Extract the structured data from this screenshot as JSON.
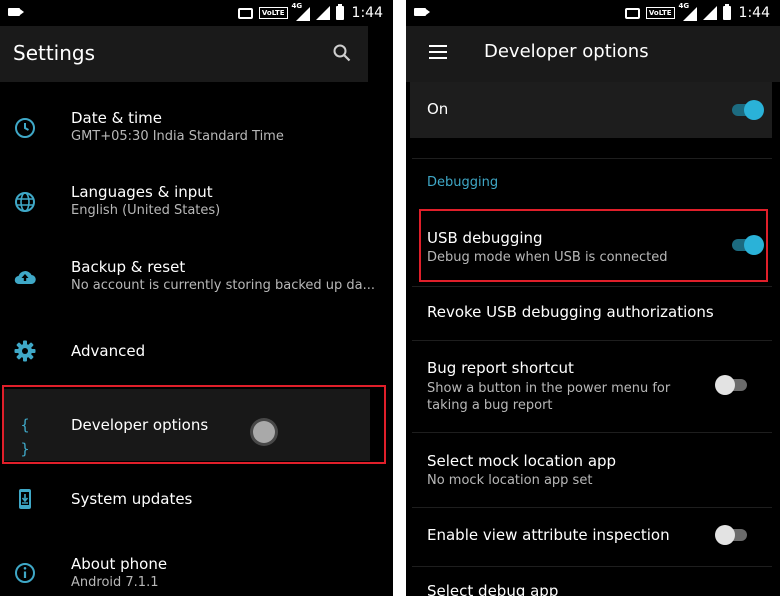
{
  "status_bar": {
    "network_label": "4G",
    "volte_label": "VoLTE",
    "time": "1:44"
  },
  "left_screen": {
    "title": "Settings",
    "items": [
      {
        "title": "Date & time",
        "subtitle": "GMT+05:30 India Standard Time",
        "icon": "clock-icon"
      },
      {
        "title": "Languages & input",
        "subtitle": "English (United States)",
        "icon": "globe-icon"
      },
      {
        "title": "Backup & reset",
        "subtitle": "No account is currently storing backed up da...",
        "icon": "cloud-upload-icon"
      },
      {
        "title": "Advanced",
        "subtitle": "",
        "icon": "gear-icon"
      },
      {
        "title": "Developer options",
        "subtitle": "",
        "icon": "braces-icon",
        "icon_text": "{ }"
      },
      {
        "title": "System updates",
        "subtitle": "",
        "icon": "phone-download-icon"
      },
      {
        "title": "About phone",
        "subtitle": "Android 7.1.1",
        "icon": "info-icon"
      }
    ]
  },
  "right_screen": {
    "title": "Developer options",
    "master_toggle": {
      "label": "On",
      "state": "on"
    },
    "section_header": "Debugging",
    "items": [
      {
        "title": "USB debugging",
        "subtitle": "Debug mode when USB is connected",
        "toggle": "on"
      },
      {
        "title": "Revoke USB debugging authorizations",
        "subtitle": ""
      },
      {
        "title": "Bug report shortcut",
        "subtitle_line1": "Show a button in the power menu for",
        "subtitle_line2": "taking a bug report",
        "toggle": "off"
      },
      {
        "title": "Select mock location app",
        "subtitle": "No mock location app set"
      },
      {
        "title": "Enable view attribute inspection",
        "subtitle": "",
        "toggle": "off"
      },
      {
        "title": "Select debug app",
        "subtitle": ""
      }
    ]
  },
  "colors": {
    "accent": "#2ab2d8",
    "highlight": "#e01f2a",
    "section_header": "#3fa8c7",
    "background": "#000000"
  }
}
